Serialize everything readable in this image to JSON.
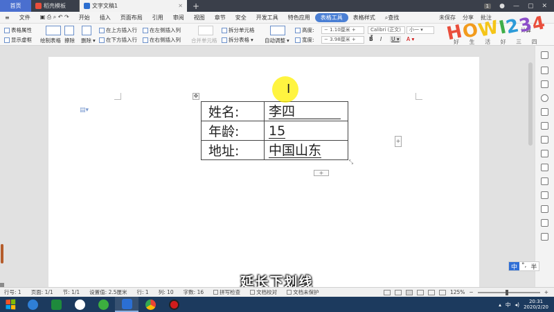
{
  "tabs": [
    {
      "label": "首页"
    },
    {
      "label": "稻壳模板"
    },
    {
      "label": "文字文稿1"
    }
  ],
  "tabbar_right": {
    "badge": "1"
  },
  "menu": {
    "file": "文件",
    "items": [
      "开始",
      "插入",
      "页面布局",
      "引用",
      "审阅",
      "视图",
      "章节",
      "安全",
      "开发工具",
      "特色应用",
      "表格工具",
      "表格样式"
    ],
    "active": "表格工具",
    "search": "查找",
    "right": [
      "未保存",
      "分享",
      "批注"
    ]
  },
  "ribbon": {
    "table_props": "表格属性",
    "show_gridlines": "显示虚框",
    "draw_table": "绘制表格",
    "eraser": "擦除",
    "delete": "删除",
    "summary": "汇总",
    "insert_above": "在上方插入行",
    "insert_below": "在下方插入行",
    "insert_left": "在左侧插入列",
    "insert_right": "在右侧插入列",
    "merge_cells": "合并单元格",
    "split_cells": "拆分单元格",
    "split_table": "拆分表格",
    "autofit": "自动调整",
    "height_label": "高度:",
    "height_value": "1.10厘米",
    "width_label": "宽度:",
    "width_value": "3.98厘米",
    "font_name": "Calibri (正文)",
    "font_size": "小一",
    "calc": "计算"
  },
  "logo": {
    "text": "HOWI234",
    "colors": [
      "#e94e3c",
      "#f29b1d",
      "#f5c518",
      "#3fae49",
      "#2d9bd8",
      "#8d4fc9",
      "#e94e3c"
    ],
    "sub": "好 生 活 好 三 四"
  },
  "document": {
    "rows": [
      {
        "label": "姓名:",
        "value": "李四"
      },
      {
        "label": "年龄:",
        "value": "15"
      },
      {
        "label": "地址:",
        "value": "中国山东"
      }
    ],
    "add_row": "+",
    "add_col": "+",
    "move_handle": "✥",
    "resize_handle": "⤡"
  },
  "ime": {
    "lang": "中",
    "items": [
      "°,",
      "半"
    ]
  },
  "subtitle": "延长下划线",
  "status": {
    "row": "行号: 1",
    "page": "页面: 1/1",
    "section": "节: 1/1",
    "setting": "设置值: 2.5厘米",
    "line": "行: 1",
    "col": "列: 10",
    "words": "字数: 16",
    "spell": "拼写检查",
    "proof": "文档校对",
    "protect": "文档未保护",
    "zoom": "125%"
  },
  "taskbar": {
    "date": "2020/2/20",
    "time": "20:31",
    "tray_lang": "中"
  }
}
